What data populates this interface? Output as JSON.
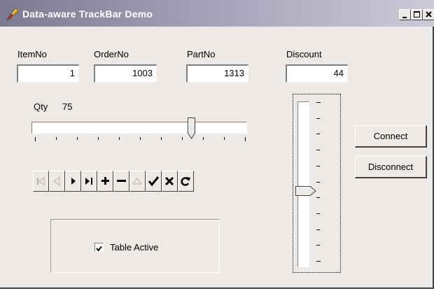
{
  "window": {
    "title": "Data-aware TrackBar Demo",
    "title_icon": "brush-icon",
    "caption_buttons": [
      "minimize-icon",
      "maximize-icon",
      "close-icon"
    ]
  },
  "fields": {
    "itemno": {
      "label": "ItemNo",
      "value": "1"
    },
    "orderno": {
      "label": "OrderNo",
      "value": "1003"
    },
    "partno": {
      "label": "PartNo",
      "value": "1313"
    },
    "discount": {
      "label": "Discount",
      "value": "44"
    }
  },
  "qty": {
    "label": "Qty",
    "value": "75",
    "level_fraction": 0.75
  },
  "discount_trackbar": {
    "level_fraction": 0.44
  },
  "navigator": {
    "buttons": [
      {
        "name": "first-record-icon",
        "enabled": false
      },
      {
        "name": "prior-record-icon",
        "enabled": false
      },
      {
        "name": "next-record-icon",
        "enabled": true
      },
      {
        "name": "last-record-icon",
        "enabled": true
      },
      {
        "name": "insert-record-icon",
        "enabled": true
      },
      {
        "name": "delete-record-icon",
        "enabled": true
      },
      {
        "name": "edit-record-icon",
        "enabled": false
      },
      {
        "name": "post-edit-icon",
        "enabled": true
      },
      {
        "name": "cancel-edit-icon",
        "enabled": true
      },
      {
        "name": "refresh-data-icon",
        "enabled": true
      }
    ]
  },
  "table_active": {
    "label": "Table Active",
    "checked": true
  },
  "buttons": {
    "connect": "Connect",
    "disconnect": "Disconnect"
  },
  "colors": {
    "face": "#ece9e6",
    "titlebar_start": "#7c7a91",
    "titlebar_end": "#cbcad7"
  }
}
